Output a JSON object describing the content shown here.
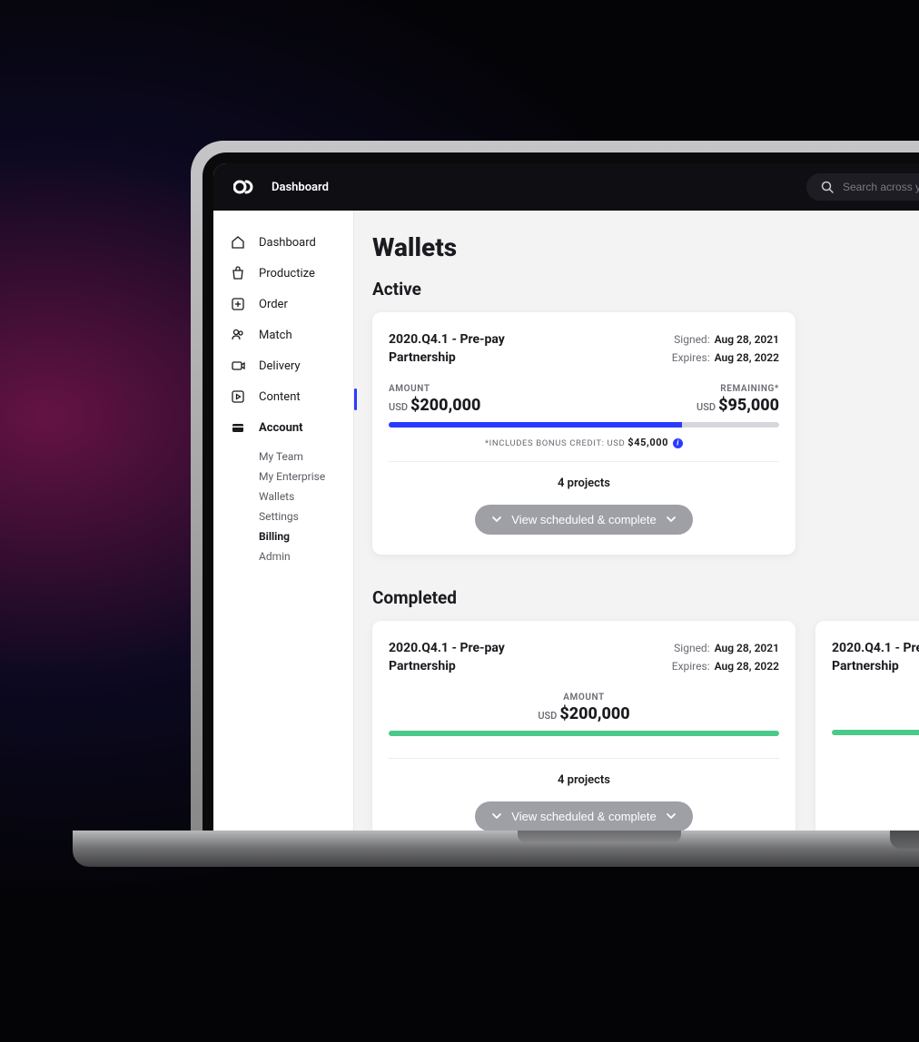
{
  "header": {
    "brand": "Dashboard",
    "search_placeholder": "Search across your brand..."
  },
  "sidebar": {
    "items": [
      {
        "label": "Dashboard"
      },
      {
        "label": "Productize"
      },
      {
        "label": "Order"
      },
      {
        "label": "Match"
      },
      {
        "label": "Delivery"
      },
      {
        "label": "Content"
      },
      {
        "label": "Account"
      }
    ],
    "sub_items": [
      {
        "label": "My Team"
      },
      {
        "label": "My Enterprise"
      },
      {
        "label": "Wallets"
      },
      {
        "label": "Settings"
      },
      {
        "label": "Billing"
      },
      {
        "label": "Admin"
      }
    ]
  },
  "page": {
    "title": "Wallets",
    "active_section": "Active",
    "completed_section": "Completed"
  },
  "active_wallet": {
    "title": "2020.Q4.1 - Pre-pay",
    "subtitle": "Partnership",
    "signed_label": "Signed:",
    "signed_value": "Aug 28, 2021",
    "expires_label": "Expires:",
    "expires_value": "Aug 28, 2022",
    "amount_label": "AMOUNT",
    "amount_currency": "USD",
    "amount_value": "$200,000",
    "remaining_label": "REMAINING*",
    "remaining_currency": "USD",
    "remaining_value": "$95,000",
    "progress_percent": 75,
    "bonus_text": "*INCLUDES BONUS CREDIT: USD",
    "bonus_amount": "$45,000",
    "projects": "4 projects",
    "expand_label": "View scheduled & complete"
  },
  "completed_wallets": [
    {
      "title": "2020.Q4.1 - Pre-pay",
      "subtitle": "Partnership",
      "signed_label": "Signed:",
      "signed_value": "Aug 28, 2021",
      "expires_label": "Expires:",
      "expires_value": "Aug 28, 2022",
      "amount_label": "AMOUNT",
      "amount_currency": "USD",
      "amount_value": "$200,000",
      "progress_percent": 100,
      "projects": "4 projects",
      "expand_label": "View scheduled & complete"
    },
    {
      "title": "2020.Q4.1 - Pre",
      "subtitle": "Partnership",
      "progress_percent": 100
    }
  ]
}
